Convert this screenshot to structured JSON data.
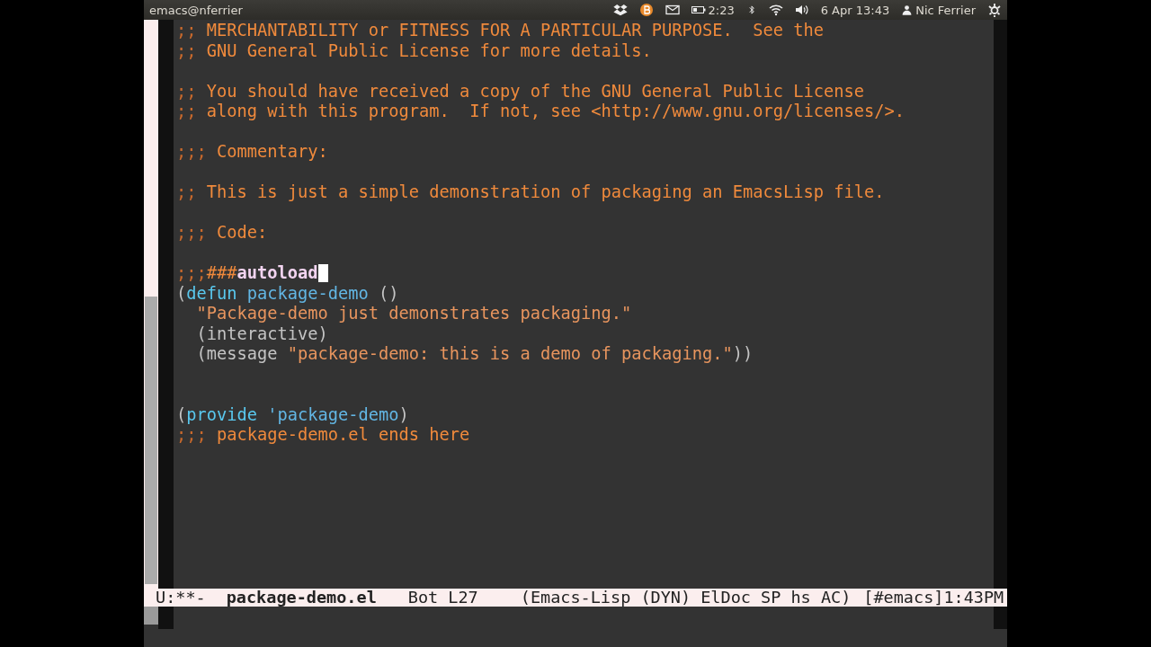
{
  "top_panel": {
    "title": "emacs@nferrier",
    "battery_time": "2:23",
    "clock": "6 Apr 13:43",
    "user": "Nic Ferrier"
  },
  "buffer": {
    "lines": [
      {
        "kind": "code",
        "segments": [
          {
            "kind": "delimiter",
            "text": ";;"
          },
          {
            "kind": "comment",
            "text": " MERCHANTABILITY or FITNESS FOR A PARTICULAR PURPOSE.  See the"
          }
        ]
      },
      {
        "kind": "code",
        "segments": [
          {
            "kind": "delimiter",
            "text": ";;"
          },
          {
            "kind": "comment",
            "text": " GNU General Public License for more details."
          }
        ]
      },
      {
        "kind": "blank"
      },
      {
        "kind": "code",
        "segments": [
          {
            "kind": "delimiter",
            "text": ";;"
          },
          {
            "kind": "comment",
            "text": " You should have received a copy of the GNU General Public License"
          }
        ]
      },
      {
        "kind": "code",
        "segments": [
          {
            "kind": "delimiter",
            "text": ";;"
          },
          {
            "kind": "comment",
            "text": " along with this program.  If not, see <http://www.gnu.org/licenses/>."
          }
        ]
      },
      {
        "kind": "blank"
      },
      {
        "kind": "code",
        "segments": [
          {
            "kind": "delimiter",
            "text": ";;;"
          },
          {
            "kind": "comment",
            "text": " Commentary:"
          }
        ]
      },
      {
        "kind": "blank"
      },
      {
        "kind": "code",
        "segments": [
          {
            "kind": "delimiter",
            "text": ";;"
          },
          {
            "kind": "comment",
            "text": " This is just a simple demonstration of packaging an EmacsLisp file."
          }
        ]
      },
      {
        "kind": "blank"
      },
      {
        "kind": "code",
        "segments": [
          {
            "kind": "delimiter",
            "text": ";;;"
          },
          {
            "kind": "comment",
            "text": " Code:"
          }
        ]
      },
      {
        "kind": "blank"
      },
      {
        "kind": "code",
        "segments": [
          {
            "kind": "delimiter",
            "text": ";;;"
          },
          {
            "kind": "comment",
            "text": "###"
          },
          {
            "kind": "cookie",
            "text": "autoload"
          },
          {
            "kind": "cursor"
          }
        ]
      },
      {
        "kind": "code",
        "segments": [
          {
            "kind": "paren",
            "text": "("
          },
          {
            "kind": "keyword",
            "text": "defun"
          },
          {
            "kind": "name",
            "text": " package-demo"
          },
          {
            "kind": "paren",
            "text": " ()"
          }
        ]
      },
      {
        "kind": "code",
        "segments": [
          {
            "kind": "string",
            "text": "  \"Package-demo just demonstrates packaging.\""
          }
        ]
      },
      {
        "kind": "code",
        "segments": [
          {
            "kind": "paren",
            "text": "  (interactive)"
          }
        ]
      },
      {
        "kind": "code",
        "segments": [
          {
            "kind": "paren",
            "text": "  (message "
          },
          {
            "kind": "string",
            "text": "\"package-demo: this is a demo of packaging.\""
          },
          {
            "kind": "paren",
            "text": "))"
          }
        ]
      },
      {
        "kind": "blank"
      },
      {
        "kind": "blank"
      },
      {
        "kind": "code",
        "segments": [
          {
            "kind": "paren",
            "text": "("
          },
          {
            "kind": "keyword",
            "text": "provide"
          },
          {
            "kind": "name",
            "text": " 'package-demo"
          },
          {
            "kind": "paren",
            "text": ")"
          }
        ]
      },
      {
        "kind": "code",
        "segments": [
          {
            "kind": "delimiter",
            "text": ";;;"
          },
          {
            "kind": "comment",
            "text": " package-demo.el ends here"
          }
        ]
      }
    ]
  },
  "mode_line": {
    "status": "U:**-",
    "buffer_name": "package-demo.el",
    "position": "Bot L27",
    "modes": "(Emacs-Lisp (DYN) ElDoc SP hs AC)",
    "extra": "[#emacs]1:43PM"
  }
}
